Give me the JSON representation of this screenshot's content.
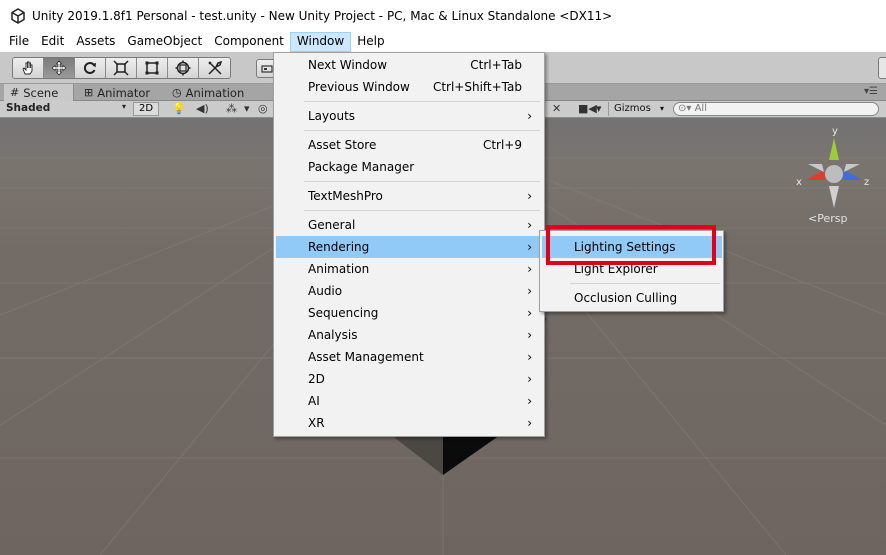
{
  "titlebar": {
    "title": "Unity 2019.1.8f1 Personal - test.unity - New Unity Project - PC, Mac & Linux Standalone <DX11>",
    "logo_icon": "unity-logo-icon"
  },
  "menubar": {
    "items": [
      "File",
      "Edit",
      "Assets",
      "GameObject",
      "Component",
      "Window",
      "Help"
    ],
    "open_item": "Window"
  },
  "toolbar": {
    "tools": [
      "hand-tool-icon",
      "move-tool-icon",
      "rotate-tool-icon",
      "scale-tool-icon",
      "rect-tool-icon",
      "transform-tool-icon",
      "custom-tool-icon"
    ],
    "active_tool": "move-tool-icon"
  },
  "tabs": {
    "items": [
      {
        "label": "Scene",
        "icon": "scene-icon"
      },
      {
        "label": "Animator",
        "icon": "animator-icon"
      },
      {
        "label": "Animation",
        "icon": "animation-icon"
      }
    ],
    "active": "Scene"
  },
  "scenebar": {
    "shading_mode": "Shaded",
    "mode_2d": "2D",
    "gizmos_label": "Gizmos",
    "search_placeholder": "All"
  },
  "viewport": {
    "persp_label": "Persp",
    "axes": {
      "x": "x",
      "y": "y",
      "z": "z"
    },
    "colors": {
      "x": "#e13b2e",
      "y": "#9ccc3a",
      "z": "#3c6ee0",
      "background": "#736c66"
    }
  },
  "window_menu": {
    "items": [
      {
        "label": "Next Window",
        "shortcut": "Ctrl+Tab"
      },
      {
        "label": "Previous Window",
        "shortcut": "Ctrl+Shift+Tab"
      },
      {
        "label": "Layouts",
        "submenu": true
      },
      {
        "label": "Asset Store",
        "shortcut": "Ctrl+9"
      },
      {
        "label": "Package Manager"
      },
      {
        "label": "TextMeshPro",
        "submenu": true
      },
      {
        "label": "General",
        "submenu": true
      },
      {
        "label": "Rendering",
        "submenu": true,
        "highlighted": true
      },
      {
        "label": "Animation",
        "submenu": true
      },
      {
        "label": "Audio",
        "submenu": true
      },
      {
        "label": "Sequencing",
        "submenu": true
      },
      {
        "label": "Analysis",
        "submenu": true
      },
      {
        "label": "Asset Management",
        "submenu": true
      },
      {
        "label": "2D",
        "submenu": true
      },
      {
        "label": "AI",
        "submenu": true
      },
      {
        "label": "XR",
        "submenu": true
      }
    ],
    "chevron": "›"
  },
  "rendering_submenu": {
    "items": [
      "Lighting Settings",
      "Light Explorer",
      "Occlusion Culling"
    ],
    "highlighted": "Lighting Settings"
  },
  "annotation": {
    "color": "#e0001a"
  }
}
